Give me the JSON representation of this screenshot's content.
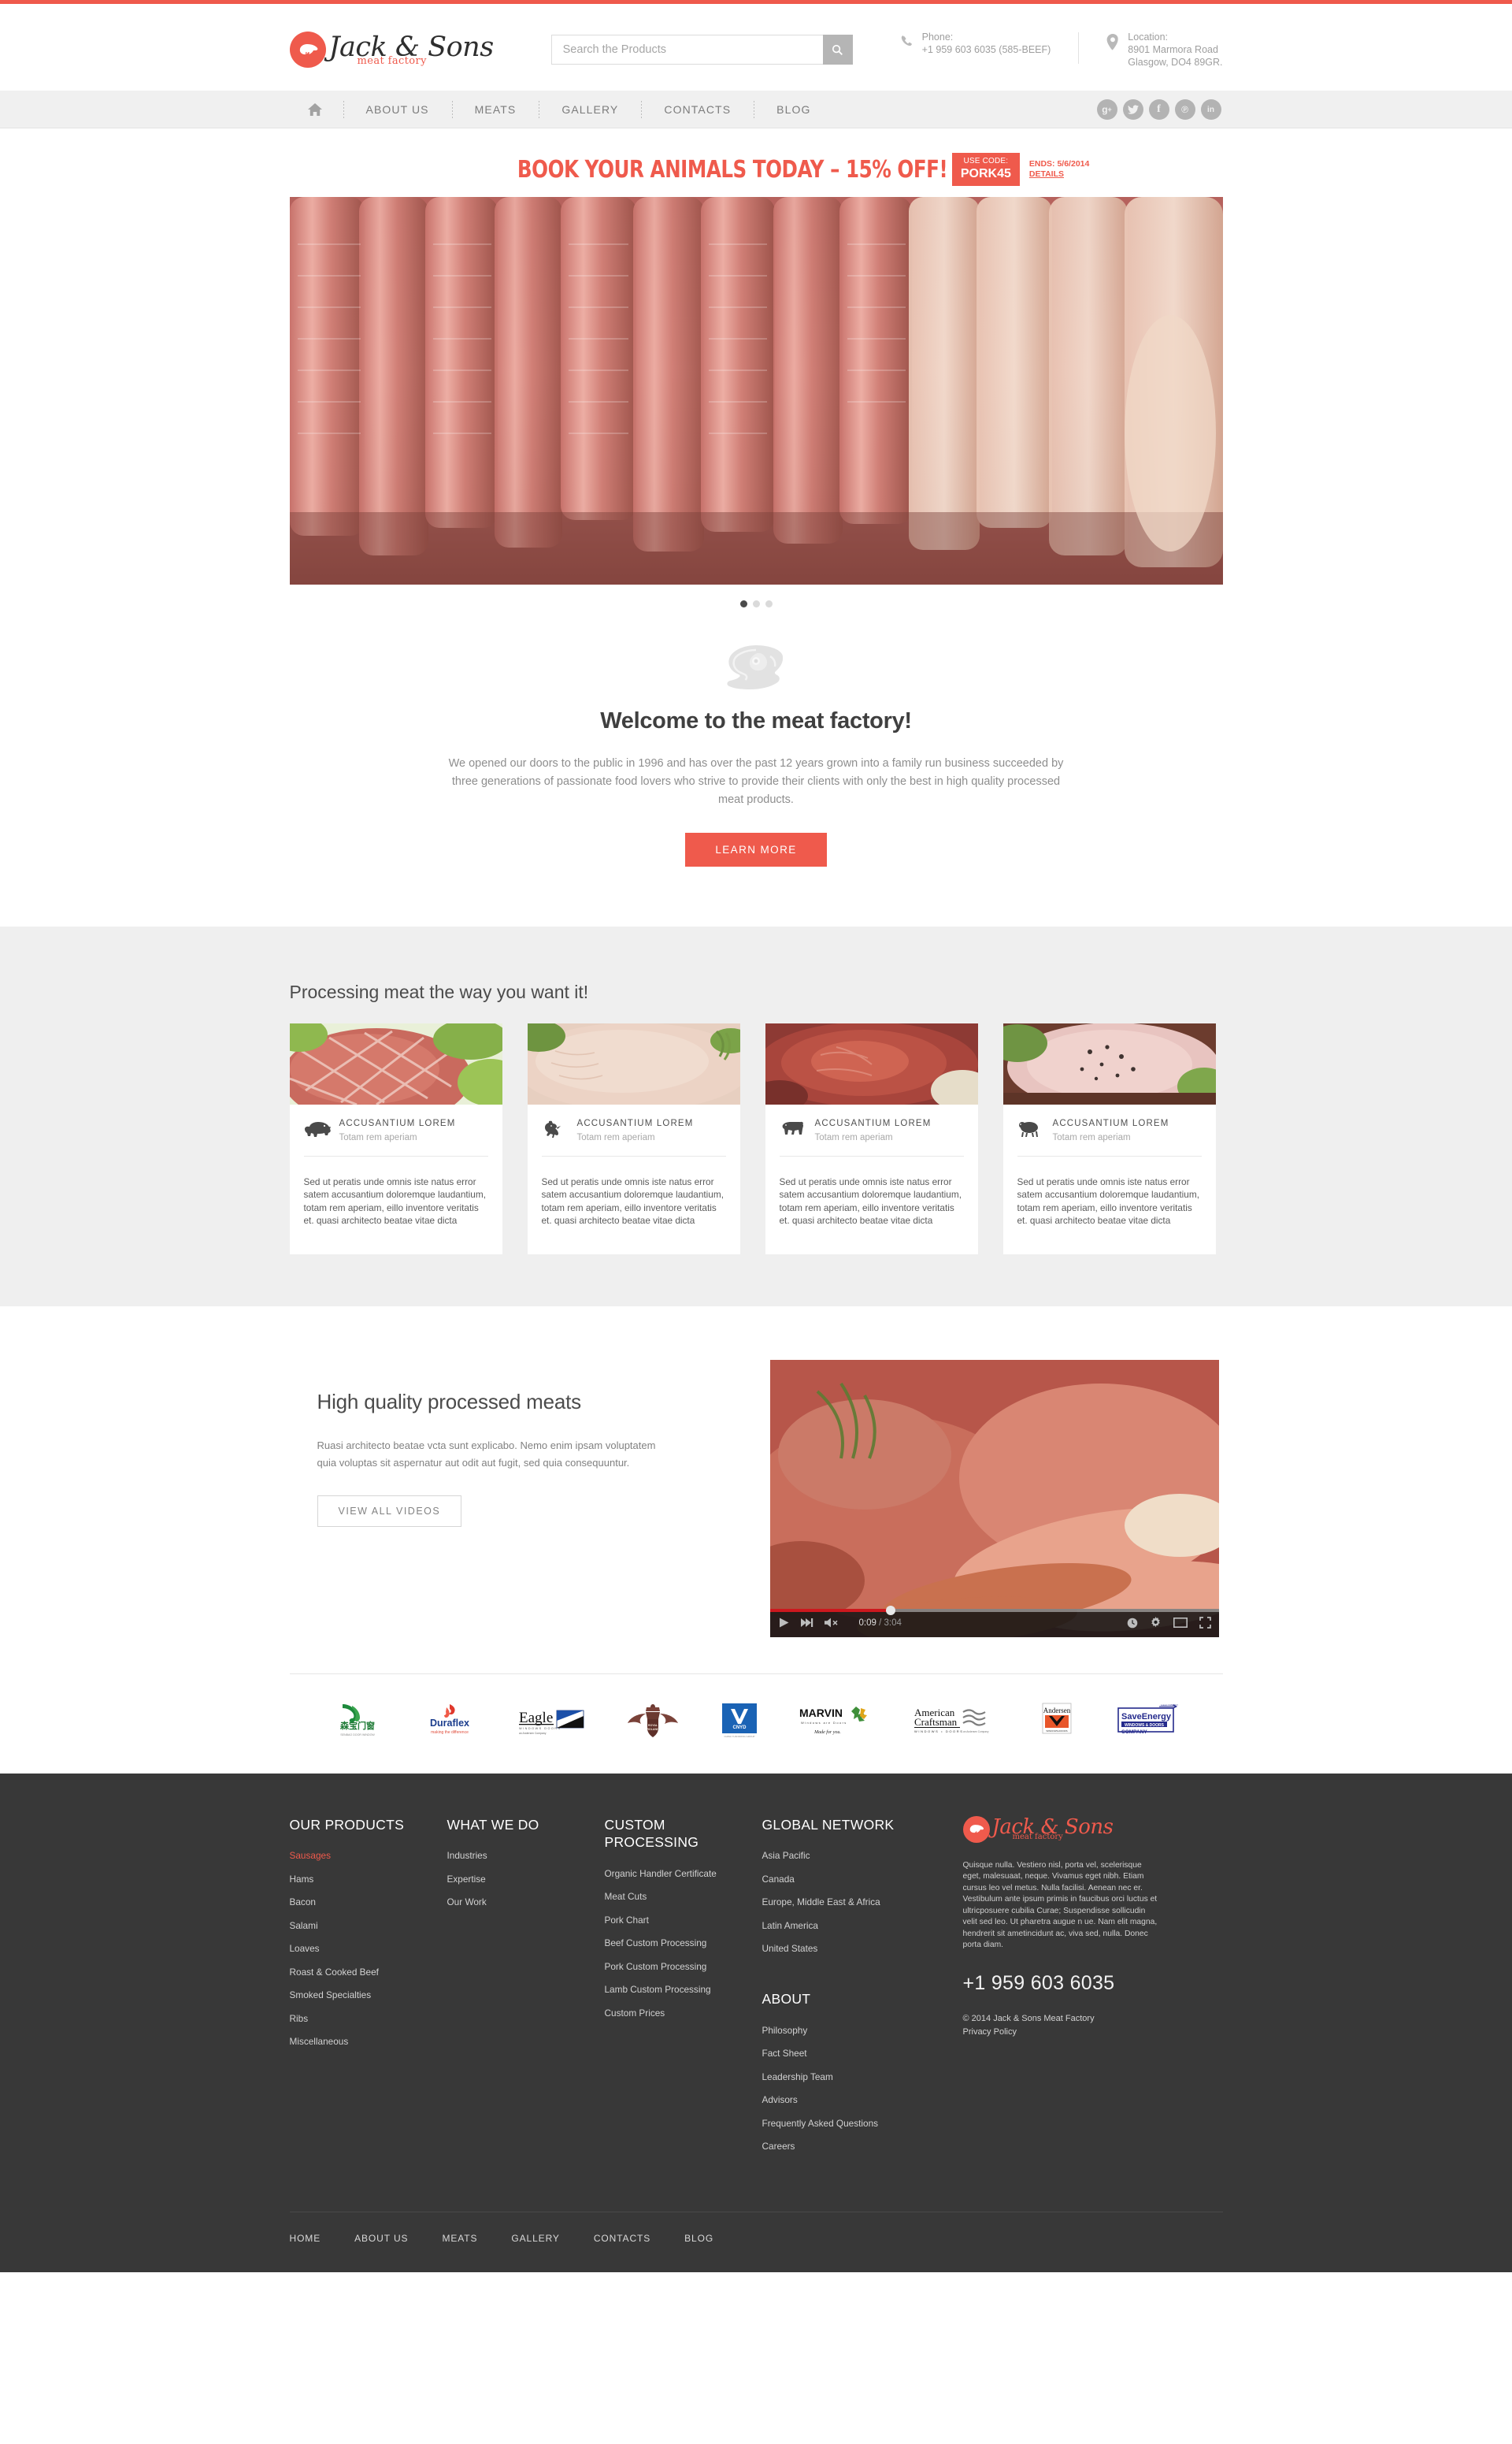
{
  "brand": {
    "name": "Jack & Sons",
    "tagline": "meat factory",
    "logo_color": "#ef5a4c"
  },
  "search": {
    "placeholder": "Search the Products",
    "value": "",
    "icon": "search-icon"
  },
  "header": {
    "phone_label": "Phone:",
    "phone_value": "+1 959 603 6035 (585-BEEF)",
    "location_label": "Location:",
    "location_line1": "8901 Marmora Road",
    "location_line2": "Glasgow, DO4 89GR."
  },
  "nav": {
    "home_icon": "home-icon",
    "items": [
      {
        "label": "ABOUT US"
      },
      {
        "label": "MEATS"
      },
      {
        "label": "GALLERY"
      },
      {
        "label": "CONTACTS"
      },
      {
        "label": "BLOG"
      }
    ],
    "social": [
      {
        "name": "google-plus-icon",
        "glyph": "g+"
      },
      {
        "name": "twitter-icon",
        "glyph": "t"
      },
      {
        "name": "facebook-icon",
        "glyph": "f"
      },
      {
        "name": "pinterest-icon",
        "glyph": "p"
      },
      {
        "name": "linkedin-icon",
        "glyph": "in"
      }
    ]
  },
  "promo": {
    "title": "BOOK YOUR ANIMALS TODAY – 15% OFF!",
    "code_label": "USE CODE:",
    "code_value": "PORK45",
    "ends": "ENDS: 5/6/2014",
    "details": "DETAILS"
  },
  "slider": {
    "dots": 3,
    "active_dot": 0
  },
  "welcome": {
    "icon": "steak-icon",
    "title": "Welcome to the meat factory!",
    "text": "We opened our doors to the public in 1996 and has over the past 12 years grown into a family run business succeeded by three generations of passionate food lovers who strive to provide their clients with only the best in high quality processed meat products.",
    "button": "LEARN MORE"
  },
  "processing": {
    "title": "Processing meat the way you want it!",
    "cards": [
      {
        "animal_icon": "pig-icon",
        "title": "ACCUSANTIUM LOREM",
        "subtitle": "Totam rem aperiam",
        "body": "Sed ut peratis unde omnis iste natus error satem accusantium doloremque laudantium, totam rem aperiam, eillo inventore veritatis et. quasi architecto beatae vitae dicta"
      },
      {
        "animal_icon": "rooster-icon",
        "title": "ACCUSANTIUM LOREM",
        "subtitle": "Totam rem aperiam",
        "body": "Sed ut peratis unde omnis iste natus error satem accusantium doloremque laudantium, totam rem aperiam, eillo inventore veritatis et. quasi architecto beatae vitae dicta"
      },
      {
        "animal_icon": "cow-icon",
        "title": "ACCUSANTIUM LOREM",
        "subtitle": "Totam rem aperiam",
        "body": "Sed ut peratis unde omnis iste natus error satem accusantium doloremque laudantium, totam rem aperiam, eillo inventore veritatis et. quasi architecto beatae vitae dicta"
      },
      {
        "animal_icon": "lamb-icon",
        "title": "ACCUSANTIUM LOREM",
        "subtitle": "Totam rem aperiam",
        "body": "Sed ut peratis unde omnis iste natus error satem accusantium doloremque laudantium, totam rem aperiam, eillo inventore veritatis et. quasi architecto beatae vitae dicta"
      }
    ]
  },
  "video_section": {
    "title": "High quality processed meats",
    "text": "Ruasi architecto beatae vcta sunt explicabo. Nemo enim ipsam voluptatem quia voluptas sit aspernatur aut odit aut fugit, sed quia consequuntur.",
    "button": "VIEW ALL VIDEOS",
    "player": {
      "current_time": "0:09",
      "separator": "/",
      "total_time": "3:04",
      "progress_percent": 27
    }
  },
  "partners": [
    {
      "name": "senbao-logo",
      "text": "森宝门窗",
      "sub": "SENBAO DOOR WINDOW"
    },
    {
      "name": "duraflex-logo",
      "text": "Duraflex",
      "sub": "making the difference"
    },
    {
      "name": "eagle-logo",
      "text": "Eagle",
      "sub": "an Andersen Company"
    },
    {
      "name": "royal-roland-logo",
      "text": "ROYAL ROLAND",
      "sub": ""
    },
    {
      "name": "cnyd-logo",
      "text": "CNYD",
      "sub": "CHINA YUANDONG GROUP"
    },
    {
      "name": "marvin-logo",
      "text": "MARVIN",
      "sub": "Windows are Doors"
    },
    {
      "name": "american-craftsman-logo",
      "text": "American Craftsman",
      "sub": "WINDOWS • DOORS"
    },
    {
      "name": "andersen-logo",
      "text": "Andersen",
      "sub": "WINDOWS•DOORS"
    },
    {
      "name": "save-energy-logo",
      "text": "SaveEnergy",
      "sub": "WINDOWS & DOORS COMPANY"
    }
  ],
  "footer": {
    "columns": [
      {
        "heading": "OUR PRODUCTS",
        "links": [
          {
            "label": "Sausages",
            "active": true
          },
          {
            "label": "Hams",
            "active": false
          },
          {
            "label": "Bacon",
            "active": false
          },
          {
            "label": "Salami",
            "active": false
          },
          {
            "label": "Loaves",
            "active": false
          },
          {
            "label": "Roast & Cooked Beef",
            "active": false
          },
          {
            "label": "Smoked Specialties",
            "active": false
          },
          {
            "label": "Ribs",
            "active": false
          },
          {
            "label": "Miscellaneous",
            "active": false
          }
        ]
      },
      {
        "heading": "WHAT WE DO",
        "links": [
          {
            "label": "Industries",
            "active": false
          },
          {
            "label": "Expertise",
            "active": false
          },
          {
            "label": "Our Work",
            "active": false
          }
        ]
      },
      {
        "heading": "CUSTOM PROCESSING",
        "links": [
          {
            "label": "Organic Handler Certificate",
            "active": false
          },
          {
            "label": "Meat Cuts",
            "active": false
          },
          {
            "label": "Pork Chart",
            "active": false
          },
          {
            "label": "Beef Custom Processing",
            "active": false
          },
          {
            "label": "Pork Custom Processing",
            "active": false
          },
          {
            "label": "Lamb Custom Processing",
            "active": false
          },
          {
            "label": "Custom Prices",
            "active": false
          }
        ]
      },
      {
        "heading": "GLOBAL NETWORK",
        "links": [
          {
            "label": "Asia Pacific",
            "active": false
          },
          {
            "label": "Canada",
            "active": false
          },
          {
            "label": "Europe, Middle East & Africa",
            "active": false
          },
          {
            "label": "Latin America",
            "active": false
          },
          {
            "label": "United States",
            "active": false
          }
        ],
        "heading2": "ABOUT",
        "links2": [
          {
            "label": "Philosophy",
            "active": false
          },
          {
            "label": "Fact Sheet",
            "active": false
          },
          {
            "label": "Leadership Team",
            "active": false
          },
          {
            "label": "Advisors",
            "active": false
          },
          {
            "label": "Frequently Asked Questions",
            "active": false
          },
          {
            "label": "Careers",
            "active": false
          }
        ]
      }
    ],
    "about": {
      "description": "Quisque nulla. Vestiero nisl, porta vel, scelerisque eget, malesuaat, neque. Vivamus eget nibh. Etiam cursus leo vel metus. Nulla facilisi. Aenean nec er. Vestibulum ante ipsum primis in faucibus orci luctus et ultricposuere cubilia Curae; Suspendisse sollicudin velit sed leo. Ut pharetra augue n ue. Nam elit magna, hendrerit sit ametincidunt ac, viva sed, nulla. Donec porta diam.",
      "phone": "+1 959 603 6035",
      "copyright": "© 2014 Jack & Sons Meat Factory",
      "privacy": "Privacy Policy"
    },
    "bottom_nav": [
      {
        "label": "HOME"
      },
      {
        "label": "ABOUT US"
      },
      {
        "label": "MEATS"
      },
      {
        "label": "GALLERY"
      },
      {
        "label": "CONTACTS"
      },
      {
        "label": "BLOG"
      }
    ]
  }
}
